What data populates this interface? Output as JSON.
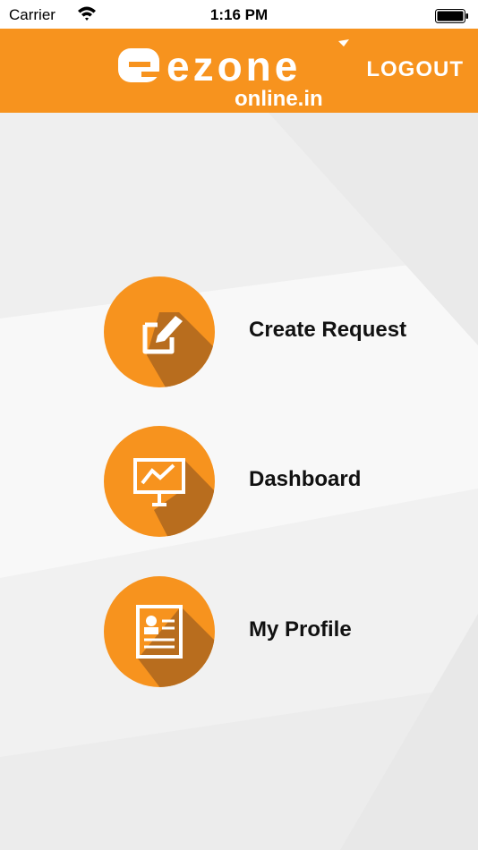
{
  "status_bar": {
    "carrier": "Carrier",
    "time": "1:16 PM"
  },
  "header": {
    "logo_brand": "ezone",
    "logo_sub": "online.in",
    "logout_label": "LOGOUT"
  },
  "colors": {
    "brand_orange": "#f7931e",
    "circle_shadow": "#b86d1e"
  },
  "menu": {
    "items": [
      {
        "label": "Create Request",
        "icon": "edit-square-icon"
      },
      {
        "label": "Dashboard",
        "icon": "presentation-chart-icon"
      },
      {
        "label": "My Profile",
        "icon": "profile-card-icon"
      }
    ]
  }
}
